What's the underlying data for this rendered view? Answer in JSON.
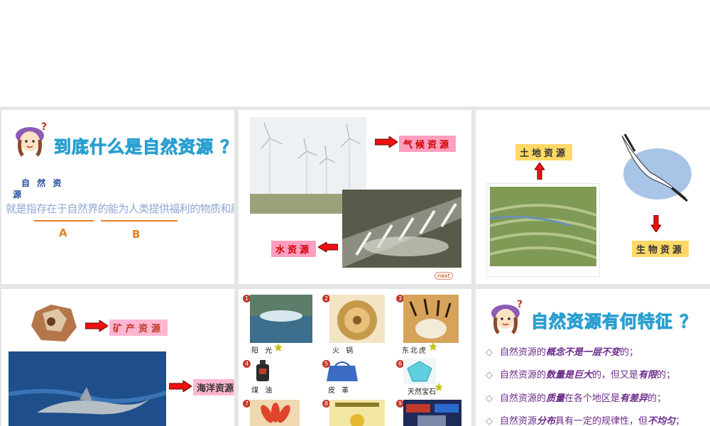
{
  "slide1": {
    "title": "到底什么是自然资源 ？",
    "term_line1": "自 然 资",
    "term_line2": "源",
    "definition": "就是指存在于自然界的能为人类提供福利的物质和能量",
    "label_a": "A",
    "label_b": "B"
  },
  "slide2": {
    "climate": "气候资源",
    "water": "水资源",
    "next": "next"
  },
  "slide3": {
    "land": "土地资源",
    "bio": "生物资源"
  },
  "slide4": {
    "mineral": "矿产资源",
    "ocean": "海洋资源"
  },
  "slide5": {
    "items": [
      {
        "n": "1",
        "label": "阳 光"
      },
      {
        "n": "2",
        "label": "火 锅"
      },
      {
        "n": "3",
        "label": "东北虎"
      },
      {
        "n": "4",
        "label": "煤 油"
      },
      {
        "n": "5",
        "label": "皮 革"
      },
      {
        "n": "6",
        "label": "天然宝石"
      },
      {
        "n": "7",
        "label": ""
      },
      {
        "n": "8",
        "label": ""
      },
      {
        "n": "9",
        "label": ""
      }
    ]
  },
  "slide6": {
    "title": "自然资源有何特征 ？",
    "f1a": "自然资源的",
    "f1b": "概念不是一层不变",
    "f1c": "的；",
    "f2a": "自然资源的",
    "f2b": "数量是巨大",
    "f2c": "的，但又是",
    "f2d": "有限",
    "f2e": "的；",
    "f3a": "自然资源的",
    "f3b": "质量",
    "f3c": "在各个地区是",
    "f3d": "有差异",
    "f3e": "的；",
    "f4a": "自然资源",
    "f4b": "分布",
    "f4c": "具有一定的规律性，但",
    "f4d": "不均匀",
    "f4e": "；"
  }
}
